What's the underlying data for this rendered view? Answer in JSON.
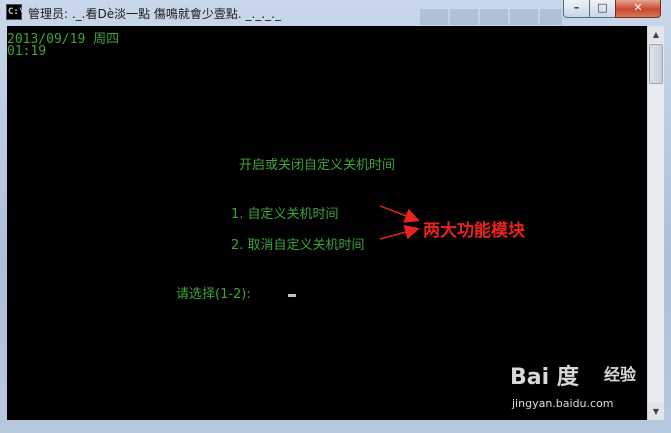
{
  "window": {
    "title": "管理员:  ._.看Dè淡一點  傷鳴就會少壹點. _._._._",
    "icon_label": "C:\\",
    "controls": {
      "minimize": "–",
      "maximize": "□",
      "close": "✕"
    }
  },
  "console": {
    "date_line": "2013/09/19 周四",
    "time_line": "01:19",
    "menu_title": "开启或关闭自定义关机时间",
    "options": [
      "1. 自定义关机时间",
      "2. 取消自定义关机时间"
    ],
    "prompt": "请选择(1-2):"
  },
  "annotation": {
    "text": "两大功能模块",
    "color": "#e8231f"
  },
  "watermark": {
    "logo": "Bai 度",
    "brand": "经验",
    "url": "jingyan.baidu.com"
  },
  "colors": {
    "console_text": "#3fa23c",
    "console_bg": "#000000"
  }
}
